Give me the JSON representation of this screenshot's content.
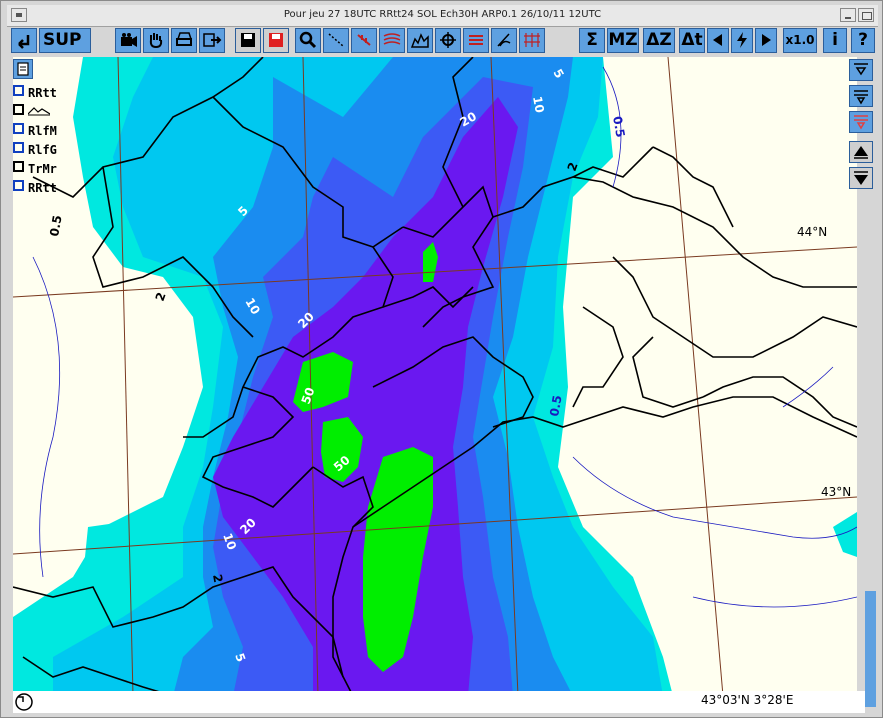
{
  "window": {
    "title": "Pour jeu 27 18UTC RRtt24 SOL Ech30H ARP0.1 26/10/11 12UTC"
  },
  "toolbar": {
    "sup_label": "SUP",
    "sigma_label": "Σ",
    "mz_label": "MZ",
    "dz_label": "ΔZ",
    "dt_label": "Δt",
    "zoom_label": "x1.0",
    "info_label": "i",
    "help_label": "?"
  },
  "layers": [
    {
      "label": "RRtt",
      "checked": true
    },
    {
      "label": "",
      "checked": false
    },
    {
      "label": "RlfM",
      "checked": true
    },
    {
      "label": "RlfG",
      "checked": true
    },
    {
      "label": "TrMr",
      "checked": false
    },
    {
      "label": "RRtt",
      "checked": true
    }
  ],
  "map": {
    "lat_labels": [
      "44°N",
      "43°N"
    ],
    "contour_labels": [
      "0.5",
      "2",
      "5",
      "10",
      "20",
      "50",
      "0.5",
      "2",
      "5",
      "10",
      "20",
      "50",
      "0.5",
      "2",
      "5",
      "10",
      "20"
    ],
    "colors": {
      "bg": "#fffff0",
      "c05": "#00e8e0",
      "c2": "#00c8f0",
      "c5": "#1a8cf0",
      "c10": "#3c5af5",
      "c20": "#6a18f0",
      "c50": "#00ee00"
    }
  },
  "status": {
    "coordinates": "43°03'N 3°28'E"
  }
}
